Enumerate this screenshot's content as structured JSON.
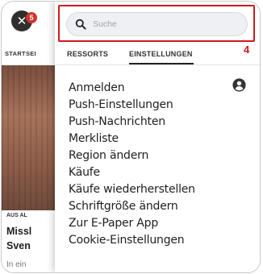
{
  "background_app": {
    "close_label": "✕",
    "notification_count": "5",
    "section_label": "STARTSEI",
    "kicker": "AUS AL",
    "headline_line1": "Missl",
    "headline_line2": "Sven",
    "teaser": "In ein"
  },
  "search": {
    "placeholder": "Suche",
    "value": ""
  },
  "annotation": {
    "label": "4",
    "color": "#d0181f"
  },
  "tabs": [
    {
      "label": "RESSORTS",
      "active": false
    },
    {
      "label": "EINSTELLUNGEN",
      "active": true
    }
  ],
  "menu": {
    "items": [
      {
        "label": "Anmelden"
      },
      {
        "label": "Push-Einstellungen"
      },
      {
        "label": "Push-Nachrichten"
      },
      {
        "label": "Merkliste"
      },
      {
        "label": "Region ändern"
      },
      {
        "label": "Käufe"
      },
      {
        "label": "Käufe wiederherstellen"
      },
      {
        "label": "Schriftgröße ändern"
      },
      {
        "label": "Zur E-Paper App"
      },
      {
        "label": "Cookie-Einstellungen"
      }
    ],
    "account_icon": "account-circle-icon"
  },
  "colors": {
    "highlight": "#d0181f",
    "badge": "#d0342c",
    "search_bg": "#eef0f3"
  }
}
